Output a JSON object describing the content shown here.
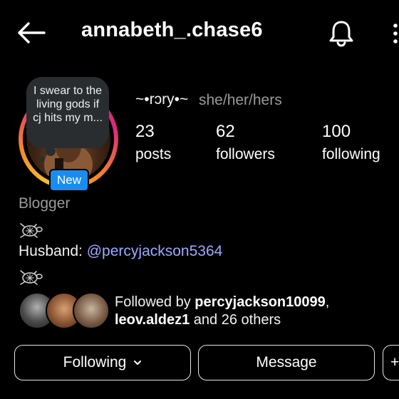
{
  "header": {
    "username": "annabeth_.chase6"
  },
  "icons": {
    "back": "back-arrow-icon",
    "notifications": "bell-icon",
    "more": "more-vertical-icon",
    "chevron": "chevron-down-icon",
    "turtle": "sea-turtle-emoji-icon"
  },
  "profile": {
    "note_text": "I swear to the living gods if cj hits my m...",
    "new_badge": "New",
    "display_name": "~•rɔry•~",
    "pronouns": "she/her/hers",
    "stats": [
      {
        "value": "23",
        "label": "posts"
      },
      {
        "value": "62",
        "label": "followers"
      },
      {
        "value": "100",
        "label": "following"
      }
    ],
    "category": "Blogger",
    "bio_prefix": "Husband: ",
    "bio_mention": "@percyjackson5364"
  },
  "followed_by": {
    "prefix": "Followed by ",
    "user1": "percyjackson10099",
    "sep": ",",
    "user2": "leov.aldez1",
    "suffix": " and 26 others"
  },
  "actions": {
    "following_label": "Following",
    "message_label": "Message",
    "add_user_label": "+"
  },
  "colors": {
    "accent_blue": "#1a8cf0",
    "mention": "#9ea9ff",
    "secondary_text": "#9a9a9a",
    "background": "#000000"
  }
}
